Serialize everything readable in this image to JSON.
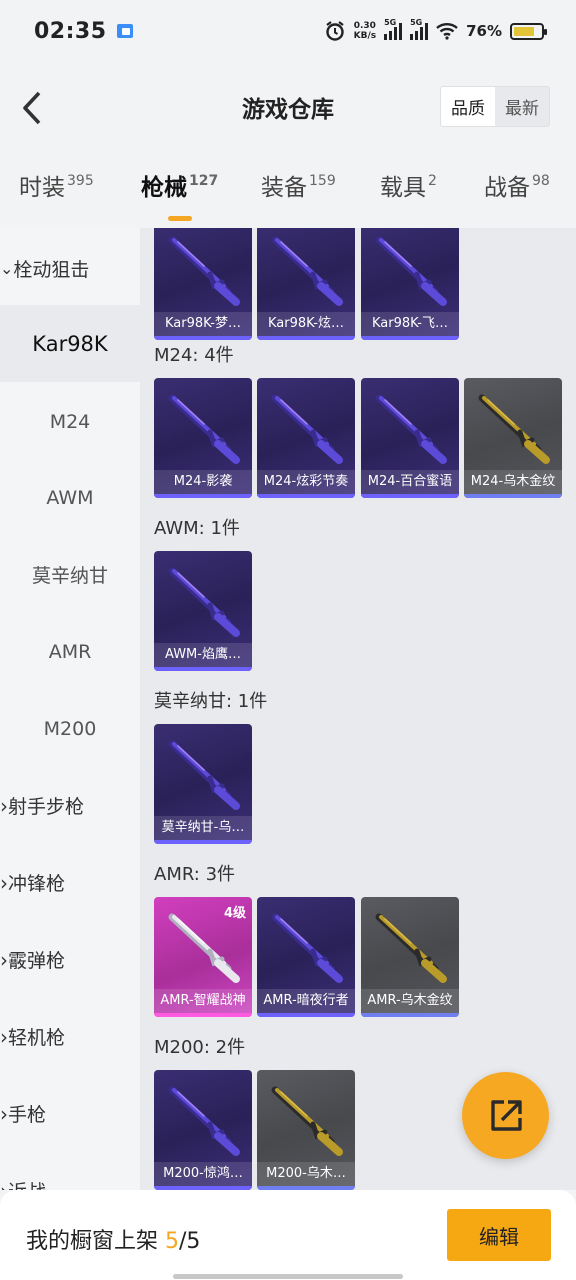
{
  "status_bar": {
    "time": "02:35",
    "net_speed_value": "0.30",
    "net_speed_unit": "KB/s",
    "sim1": "5G",
    "sim2": "5G",
    "battery": "76%",
    "battery_level": 0.76
  },
  "header": {
    "title": "游戏仓库",
    "sort_options": [
      "品质",
      "最新"
    ],
    "active_sort": "品质"
  },
  "tabs": [
    {
      "label": "时装",
      "count": "395"
    },
    {
      "label": "枪械",
      "count": "127"
    },
    {
      "label": "装备",
      "count": "159"
    },
    {
      "label": "载具",
      "count": "2"
    },
    {
      "label": "战备",
      "count": "98"
    }
  ],
  "active_tab": "枪械",
  "sidebar": {
    "items": [
      {
        "label": "栓动狙击",
        "type": "category",
        "expanded": true
      },
      {
        "label": "Kar98K",
        "type": "sub",
        "selected": true
      },
      {
        "label": "M24",
        "type": "sub"
      },
      {
        "label": "AWM",
        "type": "sub"
      },
      {
        "label": "莫辛纳甘",
        "type": "sub"
      },
      {
        "label": "AMR",
        "type": "sub"
      },
      {
        "label": "M200",
        "type": "sub"
      },
      {
        "label": "射手步枪",
        "type": "category"
      },
      {
        "label": "冲锋枪",
        "type": "category"
      },
      {
        "label": "霰弹枪",
        "type": "category"
      },
      {
        "label": "轻机枪",
        "type": "category"
      },
      {
        "label": "手枪",
        "type": "category"
      },
      {
        "label": "近战",
        "type": "category"
      }
    ]
  },
  "groups": [
    {
      "label": "",
      "items": [
        {
          "name": "Kar98K-梦…",
          "tier": "purple"
        },
        {
          "name": "Kar98K-炫…",
          "tier": "purple"
        },
        {
          "name": "Kar98K-飞…",
          "tier": "purple"
        }
      ]
    },
    {
      "label": "M24: 4件",
      "items": [
        {
          "name": "M24-影袭",
          "tier": "purple"
        },
        {
          "name": "M24-炫彩节奏",
          "tier": "purple"
        },
        {
          "name": "M24-百合蜜语",
          "tier": "purple"
        },
        {
          "name": "M24-乌木金纹",
          "tier": "grey"
        }
      ]
    },
    {
      "label": "AWM: 1件",
      "items": [
        {
          "name": "AWM-焰鹰…",
          "tier": "purple"
        }
      ]
    },
    {
      "label": "莫辛纳甘: 1件",
      "items": [
        {
          "name": "莫辛纳甘-乌…",
          "tier": "purple"
        }
      ]
    },
    {
      "label": "AMR: 3件",
      "items": [
        {
          "name": "AMR-智耀战神",
          "tier": "pink",
          "level": "4级"
        },
        {
          "name": "AMR-暗夜行者",
          "tier": "purple"
        },
        {
          "name": "AMR-乌木金纹",
          "tier": "grey"
        }
      ]
    },
    {
      "label": "M200: 2件",
      "items": [
        {
          "name": "M200-惊鸿…",
          "tier": "purple"
        },
        {
          "name": "M200-乌木…",
          "tier": "grey"
        }
      ]
    }
  ],
  "bottom_bar": {
    "label_prefix": "我的橱窗上架 ",
    "count_current": "5",
    "count_sep": "/",
    "count_total": "5",
    "edit_label": "编辑"
  },
  "colors": {
    "accent": "#f5a623",
    "purple_card": "#2a2158",
    "grey_card": "#48494d",
    "pink_card": "#c23cb4"
  },
  "icons": {
    "back": "chevron-left-icon",
    "fab": "share-export-icon",
    "category": "chevron-right-icon",
    "expanded": "chevron-down-icon"
  }
}
